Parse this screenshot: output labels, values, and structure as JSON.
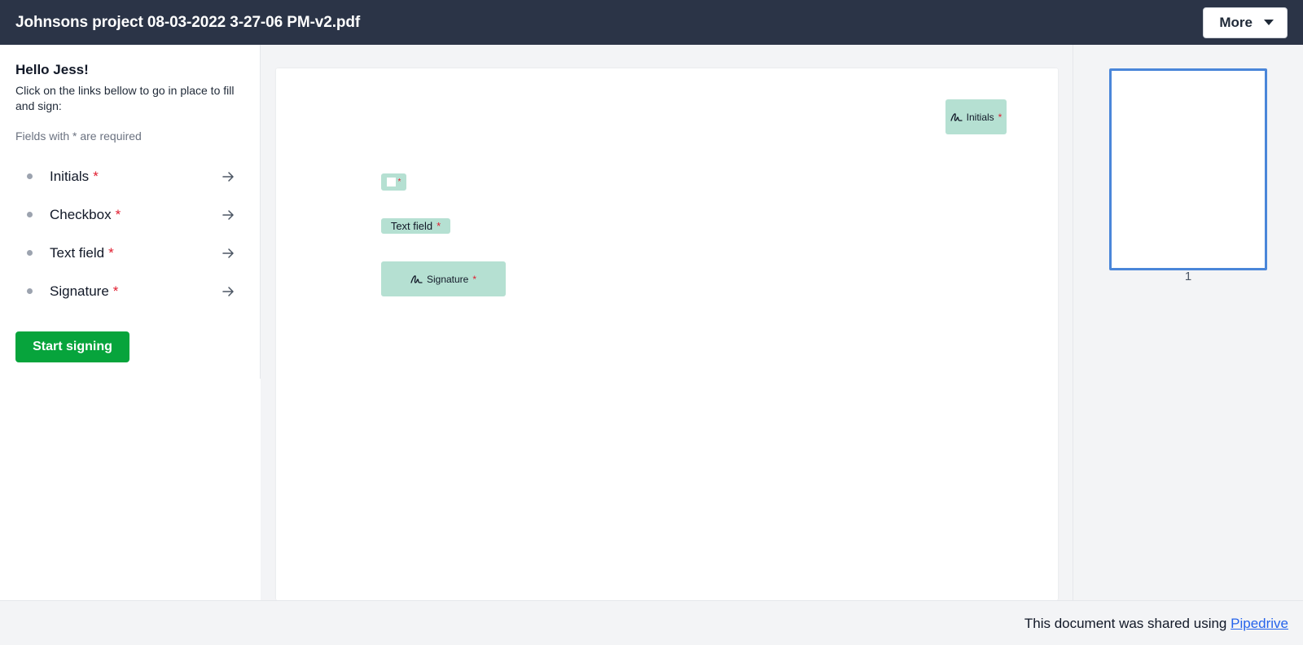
{
  "header": {
    "document_title": "Johnsons project 08-03-2022 3-27-06 PM-v2.pdf",
    "more_label": "More",
    "more_icon": "chevron-down-icon"
  },
  "sidebar": {
    "greeting": "Hello Jess!",
    "instructions": "Click on the links bellow to go in place to fill and sign:",
    "required_note": "Fields with * are required",
    "fields": [
      {
        "label": "Initials",
        "required_mark": "*",
        "icon": "arrow-right-icon"
      },
      {
        "label": "Checkbox",
        "required_mark": "*",
        "icon": "arrow-right-icon"
      },
      {
        "label": "Text field",
        "required_mark": "*",
        "icon": "arrow-right-icon"
      },
      {
        "label": "Signature",
        "required_mark": "*",
        "icon": "arrow-right-icon"
      }
    ],
    "start_button": "Start signing"
  },
  "document": {
    "initials_field": {
      "label": "Initials",
      "required_mark": "*",
      "icon": "signature-icon"
    },
    "checkbox_field": {
      "required_mark": "*",
      "checked": false
    },
    "text_field": {
      "label": "Text field",
      "required_mark": "*"
    },
    "signature_field": {
      "label": "Signature",
      "required_mark": "*",
      "icon": "signature-icon"
    }
  },
  "thumbnails": {
    "pages": [
      {
        "number": "1",
        "selected": true
      }
    ]
  },
  "footer": {
    "text": "This document was shared using",
    "link": "Pipedrive"
  },
  "colors": {
    "header_bg": "#2b3447",
    "field_fill": "#b5e0d2",
    "required": "#e11d2f",
    "primary_button": "#07a43c",
    "thumbnail_border": "#4a86d9",
    "link": "#2563eb"
  }
}
